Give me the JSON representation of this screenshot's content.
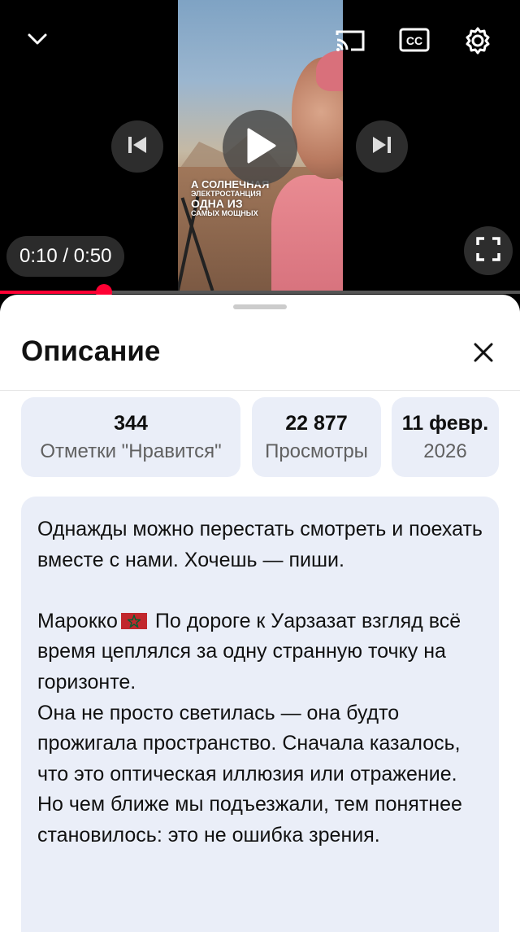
{
  "player": {
    "time_current": "0:10",
    "time_separator": " / ",
    "time_total": "0:50",
    "progress": 0.2,
    "overlay_caption": [
      "А СОЛНЕЧНАЯ",
      "ЭЛЕКТРОСТАНЦИЯ",
      "ОДНА ИЗ",
      "САМЫХ МОЩНЫХ"
    ],
    "icons": {
      "collapse": "chevron-down-icon",
      "cast": "cast-icon",
      "captions": "closed-captions-icon",
      "settings": "gear-icon",
      "previous": "skip-previous-icon",
      "play": "play-icon",
      "next": "skip-next-icon",
      "fullscreen": "fullscreen-icon"
    },
    "captions_label": "CC"
  },
  "sheet": {
    "title": "Описание",
    "close_icon": "close-icon"
  },
  "stats": [
    {
      "value": "344",
      "label": "Отметки \"Нравится\""
    },
    {
      "value": "22 877",
      "label": "Просмотры"
    },
    {
      "value": "11 февр.",
      "label": "2026"
    }
  ],
  "description": {
    "paragraph1": "Однажды можно перестать смотреть и поехать вместе с нами. Хочешь — пиши.",
    "line_country": "Марокко",
    "flag": "morocco-flag",
    "paragraph2_rest": "По дороге к Уарзазат взгляд всё время цеплялся за одну странную точку на горизонте.",
    "paragraph3": "Она не просто светилась — она будто прожигала пространство. Сначала казалось, что это оптическая иллюзия или отражение. Но чем ближе мы подъезжали, тем понятнее становилось: это не ошибка зрения."
  },
  "colors": {
    "progress": "#ff0033",
    "card_bg": "#eaeef8",
    "flag_red": "#c1272d",
    "flag_green": "#006233"
  }
}
